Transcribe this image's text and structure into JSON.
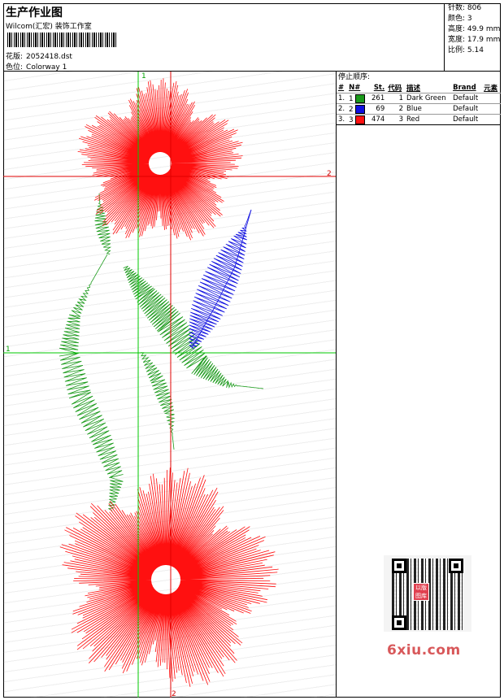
{
  "header": {
    "title": "生产作业图",
    "company": "Wilcom(汇宏) 装饰工作室",
    "design_label": "花版:",
    "design_value": "2052418.dst",
    "colorway_label": "色位:",
    "colorway_value": "Colorway 1"
  },
  "stats": [
    {
      "label": "针数:",
      "value": "806"
    },
    {
      "label": "颜色:",
      "value": "3"
    },
    {
      "label": "高度:",
      "value": "49.9 mm"
    },
    {
      "label": "宽度:",
      "value": "17.9 mm"
    },
    {
      "label": "比例:",
      "value": "5.14"
    }
  ],
  "axis_labels": {
    "v_top": "1",
    "h_right": "2",
    "h_left": "1",
    "v_bottom": "2"
  },
  "stop_sequence": {
    "title": "停止顺序:",
    "headers": [
      "#",
      "N#",
      "St.",
      "代码",
      "描述",
      "Brand",
      "元素"
    ],
    "rows": [
      {
        "seq": "1.",
        "n": "1",
        "color": "#1a9a1a",
        "st": "261",
        "code": "1",
        "desc": "Dark Green",
        "brand": "Default"
      },
      {
        "seq": "2.",
        "n": "2",
        "color": "#1010e0",
        "st": "69",
        "code": "2",
        "desc": "Blue",
        "brand": "Default"
      },
      {
        "seq": "3.",
        "n": "3",
        "color": "#ff1010",
        "st": "474",
        "code": "3",
        "desc": "Red",
        "brand": "Default"
      }
    ]
  },
  "thread_colors": {
    "green": "#1a9a1a",
    "blue": "#1010e0",
    "red": "#ff1010",
    "axis_green": "#00c800",
    "axis_red": "#e00000"
  },
  "watermark": {
    "qr_logo": "以版图库",
    "site": "6xiu.com"
  }
}
